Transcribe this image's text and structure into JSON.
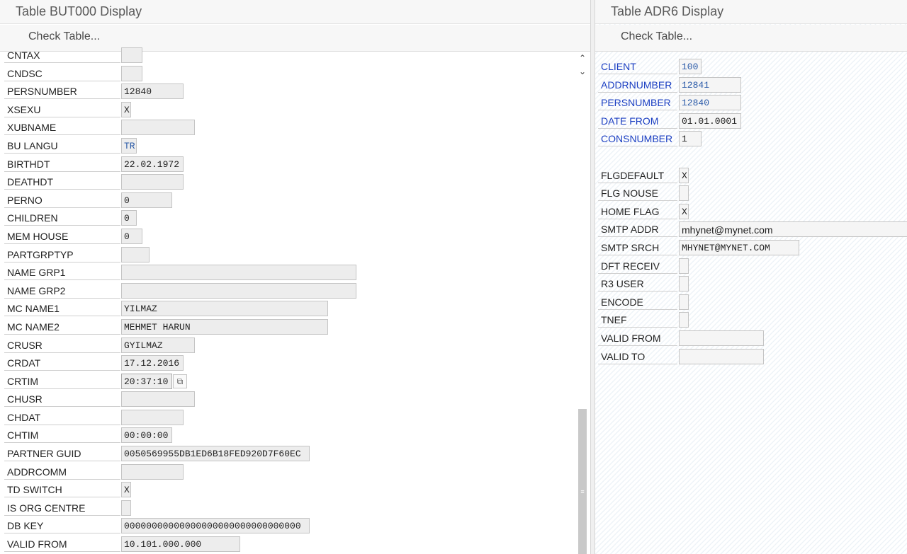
{
  "left": {
    "title": "Table BUT000 Display",
    "check_table": "Check Table...",
    "rows": [
      {
        "label": "CNTAX",
        "value": ""
      },
      {
        "label": "CNDSC",
        "value": ""
      },
      {
        "label": "PERSNUMBER",
        "value": "12840"
      },
      {
        "label": "XSEXU",
        "value": "X"
      },
      {
        "label": "XUBNAME",
        "value": ""
      },
      {
        "label": "BU LANGU",
        "value": "TR"
      },
      {
        "label": "BIRTHDT",
        "value": "22.02.1972"
      },
      {
        "label": "DEATHDT",
        "value": ""
      },
      {
        "label": "PERNO",
        "value": "0"
      },
      {
        "label": "CHILDREN",
        "value": "0"
      },
      {
        "label": "MEM HOUSE",
        "value": "0"
      },
      {
        "label": "PARTGRPTYP",
        "value": ""
      },
      {
        "label": "NAME GRP1",
        "value": ""
      },
      {
        "label": "NAME GRP2",
        "value": ""
      },
      {
        "label": "MC NAME1",
        "value": "YILMAZ"
      },
      {
        "label": "MC NAME2",
        "value": "MEHMET HARUN"
      },
      {
        "label": "CRUSR",
        "value": "GYILMAZ"
      },
      {
        "label": "CRDAT",
        "value": "17.12.2016"
      },
      {
        "label": "CRTIM",
        "value": "20:37:10"
      },
      {
        "label": "CHUSR",
        "value": ""
      },
      {
        "label": "CHDAT",
        "value": ""
      },
      {
        "label": "CHTIM",
        "value": "00:00:00"
      },
      {
        "label": "PARTNER GUID",
        "value": "0050569955DB1ED6B18FED920D7F60EC"
      },
      {
        "label": "ADDRCOMM",
        "value": ""
      },
      {
        "label": "TD SWITCH",
        "value": "X"
      },
      {
        "label": "IS ORG CENTRE",
        "value": ""
      },
      {
        "label": "DB KEY",
        "value": "00000000000000000000000000000000"
      },
      {
        "label": "VALID FROM",
        "value": "10.101.000.000"
      }
    ]
  },
  "right": {
    "title": "Table ADR6 Display",
    "check_table": "Check Table...",
    "key_rows": [
      {
        "label": "CLIENT",
        "value": "100"
      },
      {
        "label": "ADDRNUMBER",
        "value": "12841"
      },
      {
        "label": "PERSNUMBER",
        "value": "12840"
      },
      {
        "label": "DATE FROM",
        "value": "01.01.0001"
      },
      {
        "label": "CONSNUMBER",
        "value": "1"
      }
    ],
    "rows": [
      {
        "label": "FLGDEFAULT",
        "value": "X"
      },
      {
        "label": "FLG NOUSE",
        "value": ""
      },
      {
        "label": "HOME FLAG",
        "value": "X"
      },
      {
        "label": "SMTP ADDR",
        "value": "mhynet@mynet.com"
      },
      {
        "label": "SMTP SRCH",
        "value": "MHYNET@MYNET.COM"
      },
      {
        "label": "DFT RECEIV",
        "value": ""
      },
      {
        "label": "R3 USER",
        "value": ""
      },
      {
        "label": "ENCODE",
        "value": ""
      },
      {
        "label": "TNEF",
        "value": ""
      },
      {
        "label": "VALID FROM",
        "value": ""
      },
      {
        "label": "VALID TO",
        "value": ""
      }
    ]
  },
  "icons": {
    "copy": "copy-icon",
    "scroll_up": "chevron-up-icon",
    "scroll_down": "chevron-down-icon"
  }
}
